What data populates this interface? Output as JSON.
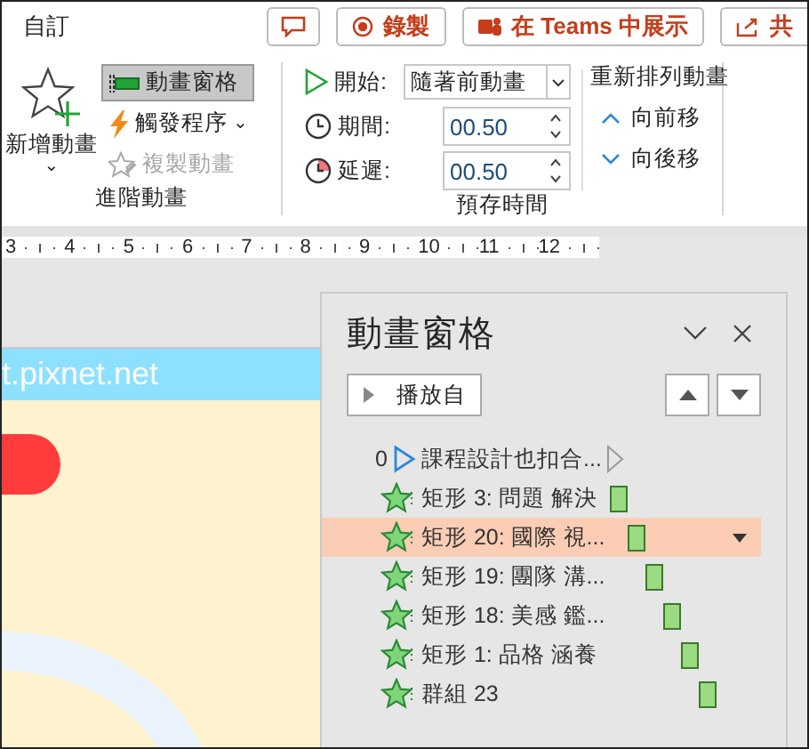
{
  "tab_label": "自訂",
  "top_buttons": [
    {
      "kind": "comment"
    },
    {
      "kind": "record",
      "label": "錄製"
    },
    {
      "kind": "teams",
      "label": "在 Teams 中展示"
    },
    {
      "kind": "share",
      "label": "共"
    }
  ],
  "advanced_group": {
    "add_button": "新增動畫",
    "caret": "⌄",
    "pane_button": {
      "label": "動畫窗格",
      "selected": true
    },
    "trigger_button": {
      "label": "觸發程序",
      "caret": "⌄"
    },
    "painter_button": {
      "label": "複製動畫",
      "disabled": true
    },
    "caption": "進階動畫"
  },
  "timing_group": {
    "start_label": "開始:",
    "start_value": "隨著前動畫",
    "duration_label": "期間:",
    "duration_value": "00.50",
    "delay_label": "延遲:",
    "delay_value": "00.50",
    "reorder_title": "重新排列動畫",
    "move_earlier": "向前移",
    "move_later": "向後移",
    "caption": "預存時間"
  },
  "ruler": [
    "3",
    "4",
    "5",
    "6",
    "7",
    "8",
    "9",
    "10",
    "11",
    "12"
  ],
  "slide": {
    "banner_text": "t.pixnet.net"
  },
  "animation_pane": {
    "title": "動畫窗格",
    "play_button": "播放自",
    "items": [
      {
        "kind": "trigger",
        "number": "0",
        "label": "課程設計也扣合...",
        "selected": false
      },
      {
        "kind": "entrance",
        "label": "矩形 3: 問題 解決",
        "selected": false
      },
      {
        "kind": "entrance",
        "label": "矩形 20: 國際 視...",
        "selected": true
      },
      {
        "kind": "entrance",
        "label": "矩形 19: 團隊 溝...",
        "selected": false
      },
      {
        "kind": "entrance",
        "label": "矩形 18: 美感 鑑...",
        "selected": false
      },
      {
        "kind": "entrance",
        "label": "矩形 1: 品格 涵養",
        "selected": false
      },
      {
        "kind": "entrance",
        "label": "群組 23",
        "selected": false
      }
    ]
  }
}
